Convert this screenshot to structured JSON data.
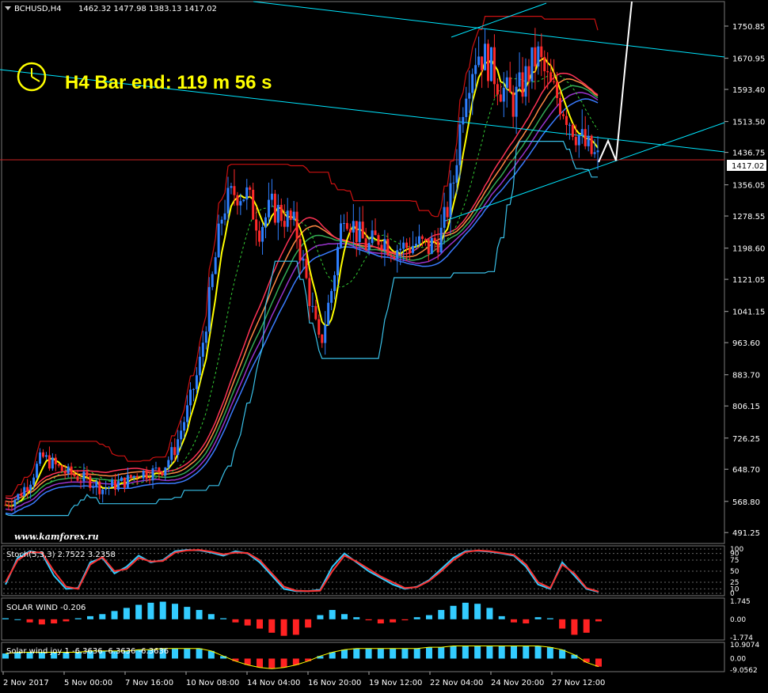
{
  "header": {
    "symbol": "BCHUSD,H4",
    "ohlc": "1462.32 1477.98 1383.13 1417.02",
    "timer": "H4 Bar end: 119 m 56 s"
  },
  "watermark": "www.kamforex.ru",
  "colors": {
    "background": "#000000",
    "bull": "#2e7fff",
    "bear": "#ff2a2a",
    "channel": "#00e6ff",
    "envelope": "#cc1111",
    "yellow": "#ffff00"
  },
  "chart_data": [
    {
      "type": "candlestick",
      "title": "BCHUSD,H4",
      "x_ticks": [
        "2 Nov 2017",
        "5 Nov 00:00",
        "7 Nov 16:00",
        "10 Nov 08:00",
        "14 Nov 04:00",
        "16 Nov 20:00",
        "19 Nov 12:00",
        "22 Nov 04:00",
        "24 Nov 20:00",
        "27 Nov 12:00"
      ],
      "y_ticks": [
        "1750.85",
        "1670.95",
        "1593.40",
        "1513.50",
        "1436.75",
        "1356.05",
        "1278.55",
        "1198.60",
        "1121.05",
        "1041.15",
        "963.60",
        "883.70",
        "806.15",
        "726.25",
        "648.70",
        "568.80",
        "491.25"
      ],
      "ylim": [
        470,
        1800
      ],
      "current_price": "1417.02",
      "close_path": [
        560,
        580,
        620,
        680,
        660,
        640,
        630,
        620,
        600,
        610,
        620,
        640,
        640,
        650,
        700,
        790,
        900,
        1100,
        1300,
        1340,
        1330,
        1250,
        1300,
        1280,
        1250,
        1100,
        950,
        1100,
        1300,
        1240,
        1200,
        1230,
        1200,
        1200,
        1210,
        1200,
        1230,
        1350,
        1600,
        1690,
        1660,
        1600,
        1560,
        1620,
        1680,
        1600,
        1560,
        1500,
        1450,
        1417
      ]
    },
    {
      "type": "line",
      "title": "Stoch(5,3,3) 2.7522 3.2358",
      "y_ticks": [
        "100",
        "90",
        "75",
        "50",
        "25",
        "10",
        "0"
      ],
      "ylim": [
        0,
        100
      ],
      "series": [
        {
          "name": "main",
          "values": [
            20,
            80,
            95,
            90,
            40,
            10,
            12,
            70,
            80,
            45,
            60,
            85,
            70,
            75,
            95,
            98,
            97,
            92,
            85,
            95,
            90,
            70,
            40,
            10,
            5,
            5,
            8,
            60,
            90,
            70,
            50,
            35,
            20,
            10,
            15,
            30,
            55,
            80,
            95,
            96,
            94,
            90,
            85,
            60,
            20,
            10,
            70,
            40,
            10,
            3
          ]
        },
        {
          "name": "signal",
          "values": [
            25,
            75,
            93,
            92,
            50,
            15,
            10,
            65,
            82,
            50,
            55,
            80,
            72,
            73,
            92,
            97,
            98,
            94,
            88,
            92,
            91,
            75,
            45,
            15,
            6,
            5,
            6,
            50,
            85,
            72,
            55,
            38,
            25,
            12,
            14,
            28,
            50,
            75,
            93,
            97,
            95,
            91,
            87,
            65,
            25,
            12,
            65,
            45,
            12,
            4
          ]
        }
      ]
    },
    {
      "type": "bar",
      "title": "SOLAR WIND -0.206",
      "y_ticks": [
        "1.745",
        "0.00",
        "-1.774"
      ],
      "ylim": [
        -1.774,
        1.745
      ],
      "values": [
        0.1,
        0.0,
        -0.3,
        -0.5,
        -0.4,
        -0.2,
        0.1,
        0.3,
        0.5,
        0.8,
        1.1,
        1.4,
        1.6,
        1.7,
        1.5,
        1.2,
        0.9,
        0.5,
        0.1,
        -0.3,
        -0.6,
        -0.9,
        -1.3,
        -1.6,
        -1.5,
        -0.8,
        0.4,
        0.9,
        0.5,
        0.2,
        -0.1,
        -0.4,
        -0.3,
        -0.1,
        0.2,
        0.4,
        0.9,
        1.3,
        1.6,
        1.5,
        1.1,
        0.3,
        -0.3,
        -0.4,
        0.2,
        0.1,
        -0.9,
        -1.5,
        -1.3,
        -0.2
      ]
    },
    {
      "type": "bar",
      "title": "Solar wind joy 1 -6.3636 -6.3636 -6.3636",
      "y_ticks": [
        "10.9074",
        "0.00",
        "-9.0562"
      ],
      "ylim": [
        -9.0562,
        10.9074
      ],
      "values": [
        4,
        5,
        5,
        5,
        5,
        5,
        5,
        6,
        6,
        6,
        6,
        7,
        7,
        8,
        8,
        8,
        8,
        6,
        2,
        -2,
        -5,
        -7,
        -8,
        -7,
        -5,
        -2,
        2,
        5,
        7,
        8,
        8,
        8,
        8,
        8,
        8,
        9,
        9,
        10,
        10,
        10,
        10,
        10,
        10,
        10,
        10,
        9,
        7,
        3,
        -3,
        -6.3636
      ]
    }
  ]
}
